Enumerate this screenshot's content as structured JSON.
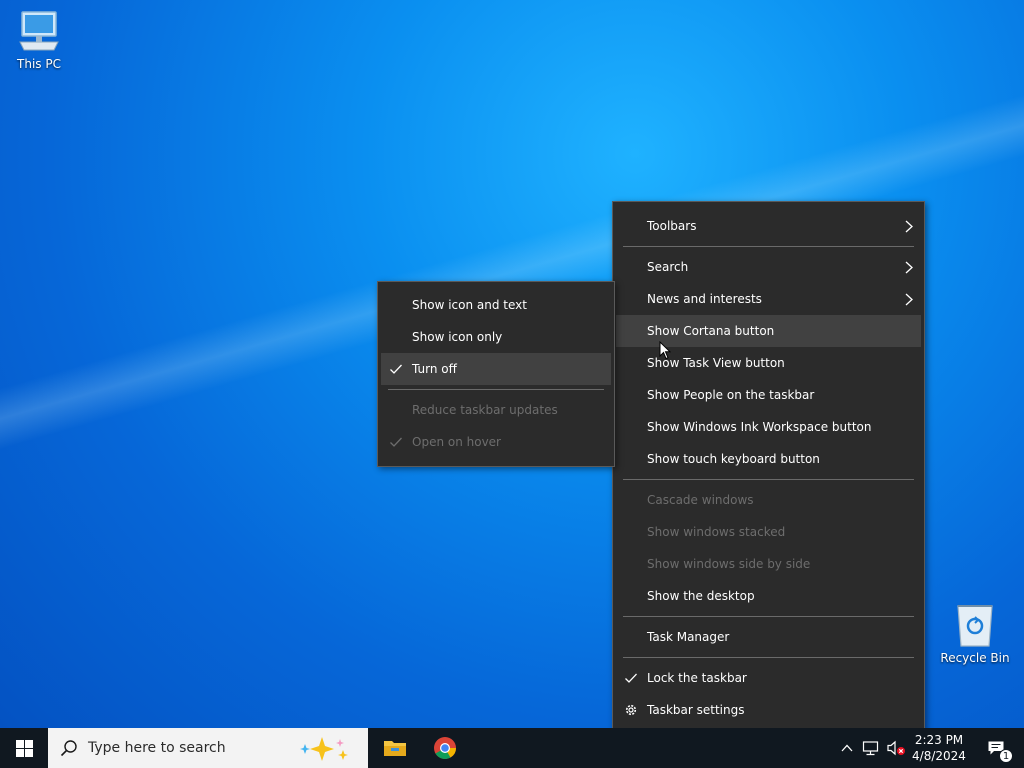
{
  "desktop": {
    "icons": [
      {
        "label": "This PC"
      },
      {
        "label": "Recycle Bin"
      }
    ]
  },
  "main_menu": {
    "items": [
      {
        "label": "Toolbars",
        "submenu": true
      },
      {
        "label": "Search",
        "submenu": true
      },
      {
        "label": "News and interests",
        "submenu": true
      },
      {
        "label": "Show Cortana button",
        "hovered": true
      },
      {
        "label": "Show Task View button"
      },
      {
        "label": "Show People on the taskbar"
      },
      {
        "label": "Show Windows Ink Workspace button"
      },
      {
        "label": "Show touch keyboard button"
      },
      {
        "label": "Cascade windows",
        "disabled": true
      },
      {
        "label": "Show windows stacked",
        "disabled": true
      },
      {
        "label": "Show windows side by side",
        "disabled": true
      },
      {
        "label": "Show the desktop"
      },
      {
        "label": "Task Manager"
      },
      {
        "label": "Lock the taskbar",
        "checked": true
      },
      {
        "label": "Taskbar settings",
        "icon": "gear-icon"
      }
    ]
  },
  "news_submenu": {
    "items": [
      {
        "label": "Show icon and text"
      },
      {
        "label": "Show icon only"
      },
      {
        "label": "Turn off",
        "checked": true,
        "hovered": true
      },
      {
        "label": "Reduce taskbar updates",
        "disabled": true
      },
      {
        "label": "Open on hover",
        "checked": true,
        "disabled": true
      }
    ]
  },
  "taskbar": {
    "search_placeholder": "Type here to search",
    "pinned": [
      {
        "name": "File Explorer",
        "icon": "folder-icon"
      },
      {
        "name": "Google Chrome",
        "icon": "chrome-icon"
      }
    ],
    "clock": {
      "time": "2:23 PM",
      "date": "4/8/2024"
    },
    "notification_count": "1"
  },
  "colors": {
    "menu_bg": "#2b2b2b",
    "menu_hover": "#414141",
    "menu_disabled_text": "#6d6d6d",
    "taskbar_bg": "#101820",
    "desktop_blue": "#0a8ff0"
  }
}
